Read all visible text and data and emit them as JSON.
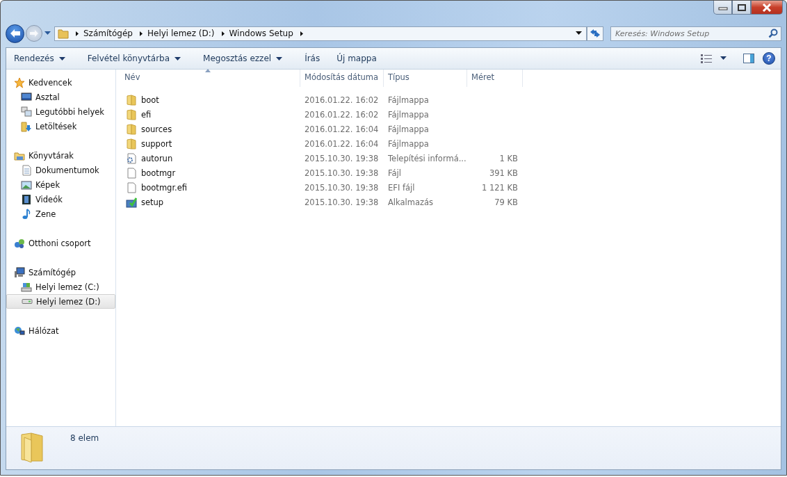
{
  "address": {
    "crumbs": [
      "Számítógép",
      "Helyi lemez (D:)",
      "Windows Setup"
    ]
  },
  "search": {
    "placeholder": "Keresés: Windows Setup"
  },
  "toolbar": {
    "buttons": [
      {
        "label": "Rendezés",
        "dropdown": true
      },
      {
        "label": "Felvétel könyvtárba",
        "dropdown": true
      },
      {
        "label": "Megosztás ezzel",
        "dropdown": true
      },
      {
        "label": "Írás",
        "dropdown": false
      },
      {
        "label": "Új mappa",
        "dropdown": false
      }
    ],
    "help": "?"
  },
  "sidebar": {
    "groups": [
      {
        "label": "Kedvencek",
        "children": [
          {
            "label": "Asztal",
            "selected": false
          },
          {
            "label": "Legutóbbi helyek",
            "selected": false
          },
          {
            "label": "Letöltések",
            "selected": false
          }
        ]
      },
      {
        "label": "Könyvtárak",
        "children": [
          {
            "label": "Dokumentumok",
            "selected": false
          },
          {
            "label": "Képek",
            "selected": false
          },
          {
            "label": "Videók",
            "selected": false
          },
          {
            "label": "Zene",
            "selected": false
          }
        ]
      },
      {
        "label": "Otthoni csoport"
      },
      {
        "label": "Számítógép",
        "children": [
          {
            "label": "Helyi lemez (C:)",
            "selected": false
          },
          {
            "label": "Helyi lemez (D:)",
            "selected": true
          }
        ]
      },
      {
        "label": "Hálózat"
      }
    ]
  },
  "table": {
    "columns": [
      {
        "label": "Név",
        "sorted": true
      },
      {
        "label": "Módosítás dátuma",
        "sorted": false
      },
      {
        "label": "Típus",
        "sorted": false
      },
      {
        "label": "Méret",
        "sorted": false
      }
    ],
    "rows": [
      {
        "kind": "folder",
        "name": "boot",
        "date": "2016.01.22. 16:02",
        "type": "Fájlmappa"
      },
      {
        "kind": "folder",
        "name": "efi",
        "date": "2016.01.22. 16:02",
        "type": "Fájlmappa"
      },
      {
        "kind": "folder",
        "name": "sources",
        "date": "2016.01.22. 16:04",
        "type": "Fájlmappa"
      },
      {
        "kind": "folder",
        "name": "support",
        "date": "2016.01.22. 16:04",
        "type": "Fájlmappa"
      },
      {
        "kind": "settings",
        "name": "autorun",
        "date": "2015.10.30. 19:38",
        "type": "Telepítési informá...",
        "size": "1 KB"
      },
      {
        "kind": "file",
        "name": "bootmgr",
        "date": "2015.10.30. 19:38",
        "type": "Fájl",
        "size": "391 KB"
      },
      {
        "kind": "file",
        "name": "bootmgr.efi",
        "date": "2015.10.30. 19:38",
        "type": "EFI fájl",
        "size": "1 121 KB"
      },
      {
        "kind": "app",
        "name": "setup",
        "date": "2015.10.30. 19:38",
        "type": "Alkalmazás",
        "size": "79 KB"
      }
    ]
  },
  "status_bar": {
    "count": "8 elem"
  }
}
